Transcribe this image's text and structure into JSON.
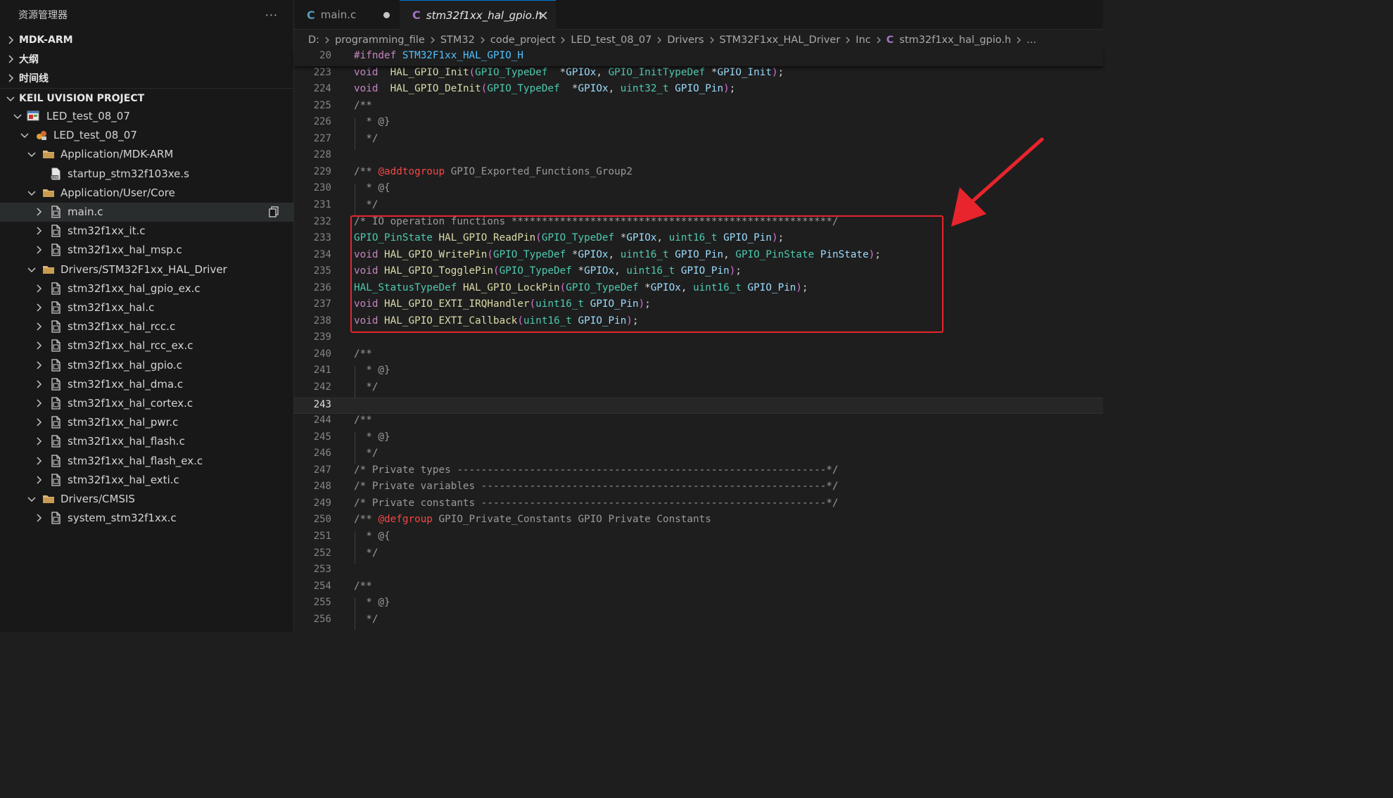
{
  "sidebar": {
    "title": "资源管理器",
    "more_label": "···",
    "sections": [
      {
        "label": "MDK-ARM",
        "expanded": false
      },
      {
        "label": "大纲",
        "expanded": false
      },
      {
        "label": "时间线",
        "expanded": false
      },
      {
        "label": "KEIL UVISION PROJECT",
        "expanded": true
      }
    ],
    "tree": [
      {
        "label": "LED_test_08_07",
        "depth": 0,
        "chevron": "down",
        "icon": "keil-project-icon"
      },
      {
        "label": "LED_test_08_07",
        "depth": 1,
        "chevron": "down",
        "icon": "keil-target-icon"
      },
      {
        "label": "Application/MDK-ARM",
        "depth": 2,
        "chevron": "down",
        "icon": "folder-icon"
      },
      {
        "label": "startup_stm32f103xe.s",
        "depth": 3,
        "chevron": "none",
        "icon": "asm-file-icon"
      },
      {
        "label": "Application/User/Core",
        "depth": 2,
        "chevron": "down",
        "icon": "folder-icon"
      },
      {
        "label": "main.c",
        "depth": 3,
        "chevron": "right",
        "icon": "c-file-icon",
        "selected": true
      },
      {
        "label": "stm32f1xx_it.c",
        "depth": 3,
        "chevron": "right",
        "icon": "c-file-icon"
      },
      {
        "label": "stm32f1xx_hal_msp.c",
        "depth": 3,
        "chevron": "right",
        "icon": "c-file-icon"
      },
      {
        "label": "Drivers/STM32F1xx_HAL_Driver",
        "depth": 2,
        "chevron": "down",
        "icon": "folder-icon"
      },
      {
        "label": "stm32f1xx_hal_gpio_ex.c",
        "depth": 3,
        "chevron": "right",
        "icon": "c-file-icon"
      },
      {
        "label": "stm32f1xx_hal.c",
        "depth": 3,
        "chevron": "right",
        "icon": "c-file-icon"
      },
      {
        "label": "stm32f1xx_hal_rcc.c",
        "depth": 3,
        "chevron": "right",
        "icon": "c-file-icon"
      },
      {
        "label": "stm32f1xx_hal_rcc_ex.c",
        "depth": 3,
        "chevron": "right",
        "icon": "c-file-icon"
      },
      {
        "label": "stm32f1xx_hal_gpio.c",
        "depth": 3,
        "chevron": "right",
        "icon": "c-file-icon"
      },
      {
        "label": "stm32f1xx_hal_dma.c",
        "depth": 3,
        "chevron": "right",
        "icon": "c-file-icon"
      },
      {
        "label": "stm32f1xx_hal_cortex.c",
        "depth": 3,
        "chevron": "right",
        "icon": "c-file-icon"
      },
      {
        "label": "stm32f1xx_hal_pwr.c",
        "depth": 3,
        "chevron": "right",
        "icon": "c-file-icon"
      },
      {
        "label": "stm32f1xx_hal_flash.c",
        "depth": 3,
        "chevron": "right",
        "icon": "c-file-icon"
      },
      {
        "label": "stm32f1xx_hal_flash_ex.c",
        "depth": 3,
        "chevron": "right",
        "icon": "c-file-icon"
      },
      {
        "label": "stm32f1xx_hal_exti.c",
        "depth": 3,
        "chevron": "right",
        "icon": "c-file-icon"
      },
      {
        "label": "Drivers/CMSIS",
        "depth": 2,
        "chevron": "down",
        "icon": "folder-icon"
      },
      {
        "label": "system_stm32f1xx.c",
        "depth": 3,
        "chevron": "right",
        "icon": "c-file-icon"
      }
    ]
  },
  "tabs": [
    {
      "icon_letter": "C",
      "label": "main.c",
      "active": false,
      "modified": true
    },
    {
      "icon_letter": "C",
      "label": "stm32f1xx_hal_gpio.h",
      "active": true,
      "modified": false
    }
  ],
  "breadcrumb": {
    "parts": [
      "D:",
      "programming_file",
      "STM32",
      "code_project",
      "LED_test_08_07",
      "Drivers",
      "STM32F1xx_HAL_Driver",
      "Inc"
    ],
    "file_icon": "C",
    "file": "stm32f1xx_hal_gpio.h",
    "trailing": "..."
  },
  "editor": {
    "current_line": "243",
    "highlighted_range": [
      "232",
      "238"
    ],
    "lines": [
      {
        "n": "20",
        "sticky": true,
        "tokens": [
          [
            "k",
            "#ifndef"
          ],
          [
            "",
            ""
          ],
          [
            "mac",
            " STM32F1xx_HAL_GPIO_H"
          ]
        ]
      },
      {
        "n": "223",
        "tokens": [
          [
            "k",
            "void"
          ],
          [
            "",
            "  "
          ],
          [
            "f",
            "HAL_GPIO_Init"
          ],
          [
            "p",
            "("
          ],
          [
            "t",
            "GPIO_TypeDef"
          ],
          [
            "",
            "  *"
          ],
          [
            "v",
            "GPIOx"
          ],
          [
            "",
            ", "
          ],
          [
            "t",
            "GPIO_InitTypeDef"
          ],
          [
            "",
            " *"
          ],
          [
            "v",
            "GPIO_Init"
          ],
          [
            "p",
            ")"
          ],
          [
            "",
            ";"
          ]
        ]
      },
      {
        "n": "224",
        "tokens": [
          [
            "k",
            "void"
          ],
          [
            "",
            "  "
          ],
          [
            "f",
            "HAL_GPIO_DeInit"
          ],
          [
            "p",
            "("
          ],
          [
            "t",
            "GPIO_TypeDef"
          ],
          [
            "",
            "  *"
          ],
          [
            "v",
            "GPIOx"
          ],
          [
            "",
            ", "
          ],
          [
            "t",
            "uint32_t"
          ],
          [
            "",
            " "
          ],
          [
            "v",
            "GPIO_Pin"
          ],
          [
            "p",
            ")"
          ],
          [
            "",
            ";"
          ]
        ]
      },
      {
        "n": "225",
        "tokens": [
          [
            "cm",
            "/**"
          ]
        ]
      },
      {
        "n": "226",
        "tokens": [
          [
            "cm",
            "  * @}"
          ]
        ]
      },
      {
        "n": "227",
        "tokens": [
          [
            "cm",
            "  */"
          ]
        ]
      },
      {
        "n": "228",
        "tokens": []
      },
      {
        "n": "229",
        "tokens": [
          [
            "cm",
            "/** "
          ],
          [
            "tag",
            "@addtogroup"
          ],
          [
            "cm",
            " GPIO_Exported_Functions_Group2"
          ]
        ]
      },
      {
        "n": "230",
        "tokens": [
          [
            "cm",
            "  * @{"
          ]
        ]
      },
      {
        "n": "231",
        "tokens": [
          [
            "cm",
            "  */"
          ]
        ]
      },
      {
        "n": "232",
        "tokens": [
          [
            "cm",
            "/* IO operation functions *****************************************************/"
          ]
        ]
      },
      {
        "n": "233",
        "tokens": [
          [
            "t",
            "GPIO_PinState"
          ],
          [
            "",
            " "
          ],
          [
            "f",
            "HAL_GPIO_ReadPin"
          ],
          [
            "p",
            "("
          ],
          [
            "t",
            "GPIO_TypeDef"
          ],
          [
            "",
            " *"
          ],
          [
            "v",
            "GPIOx"
          ],
          [
            "",
            ", "
          ],
          [
            "t",
            "uint16_t"
          ],
          [
            "",
            " "
          ],
          [
            "v",
            "GPIO_Pin"
          ],
          [
            "p",
            ")"
          ],
          [
            "",
            ";"
          ]
        ]
      },
      {
        "n": "234",
        "tokens": [
          [
            "k",
            "void"
          ],
          [
            "",
            " "
          ],
          [
            "f",
            "HAL_GPIO_WritePin"
          ],
          [
            "p",
            "("
          ],
          [
            "t",
            "GPIO_TypeDef"
          ],
          [
            "",
            " *"
          ],
          [
            "v",
            "GPIOx"
          ],
          [
            "",
            ", "
          ],
          [
            "t",
            "uint16_t"
          ],
          [
            "",
            " "
          ],
          [
            "v",
            "GPIO_Pin"
          ],
          [
            "",
            ", "
          ],
          [
            "t",
            "GPIO_PinState"
          ],
          [
            "",
            " "
          ],
          [
            "v",
            "PinState"
          ],
          [
            "p",
            ")"
          ],
          [
            "",
            ";"
          ]
        ]
      },
      {
        "n": "235",
        "tokens": [
          [
            "k",
            "void"
          ],
          [
            "",
            " "
          ],
          [
            "f",
            "HAL_GPIO_TogglePin"
          ],
          [
            "p",
            "("
          ],
          [
            "t",
            "GPIO_TypeDef"
          ],
          [
            "",
            " *"
          ],
          [
            "v",
            "GPIOx"
          ],
          [
            "",
            ", "
          ],
          [
            "t",
            "uint16_t"
          ],
          [
            "",
            " "
          ],
          [
            "v",
            "GPIO_Pin"
          ],
          [
            "p",
            ")"
          ],
          [
            "",
            ";"
          ]
        ]
      },
      {
        "n": "236",
        "tokens": [
          [
            "t",
            "HAL_StatusTypeDef"
          ],
          [
            "",
            " "
          ],
          [
            "f",
            "HAL_GPIO_LockPin"
          ],
          [
            "p",
            "("
          ],
          [
            "t",
            "GPIO_TypeDef"
          ],
          [
            "",
            " *"
          ],
          [
            "v",
            "GPIOx"
          ],
          [
            "",
            ", "
          ],
          [
            "t",
            "uint16_t"
          ],
          [
            "",
            " "
          ],
          [
            "v",
            "GPIO_Pin"
          ],
          [
            "p",
            ")"
          ],
          [
            "",
            ";"
          ]
        ]
      },
      {
        "n": "237",
        "tokens": [
          [
            "k",
            "void"
          ],
          [
            "",
            " "
          ],
          [
            "f",
            "HAL_GPIO_EXTI_IRQHandler"
          ],
          [
            "p",
            "("
          ],
          [
            "t",
            "uint16_t"
          ],
          [
            "",
            " "
          ],
          [
            "v",
            "GPIO_Pin"
          ],
          [
            "p",
            ")"
          ],
          [
            "",
            ";"
          ]
        ]
      },
      {
        "n": "238",
        "tokens": [
          [
            "k",
            "void"
          ],
          [
            "",
            " "
          ],
          [
            "f",
            "HAL_GPIO_EXTI_Callback"
          ],
          [
            "p",
            "("
          ],
          [
            "t",
            "uint16_t"
          ],
          [
            "",
            " "
          ],
          [
            "v",
            "GPIO_Pin"
          ],
          [
            "p",
            ")"
          ],
          [
            "",
            ";"
          ]
        ]
      },
      {
        "n": "239",
        "tokens": []
      },
      {
        "n": "240",
        "tokens": [
          [
            "cm",
            "/**"
          ]
        ]
      },
      {
        "n": "241",
        "tokens": [
          [
            "cm",
            "  * @}"
          ]
        ]
      },
      {
        "n": "242",
        "tokens": [
          [
            "cm",
            "  */"
          ]
        ]
      },
      {
        "n": "243",
        "tokens": []
      },
      {
        "n": "244",
        "tokens": [
          [
            "cm",
            "/**"
          ]
        ]
      },
      {
        "n": "245",
        "tokens": [
          [
            "cm",
            "  * @}"
          ]
        ]
      },
      {
        "n": "246",
        "tokens": [
          [
            "cm",
            "  */"
          ]
        ]
      },
      {
        "n": "247",
        "tokens": [
          [
            "cm",
            "/* Private types -------------------------------------------------------------*/"
          ]
        ]
      },
      {
        "n": "248",
        "tokens": [
          [
            "cm",
            "/* Private variables ---------------------------------------------------------*/"
          ]
        ]
      },
      {
        "n": "249",
        "tokens": [
          [
            "cm",
            "/* Private constants ---------------------------------------------------------*/"
          ]
        ]
      },
      {
        "n": "250",
        "tokens": [
          [
            "cm",
            "/** "
          ],
          [
            "tag",
            "@defgroup"
          ],
          [
            "cm",
            " GPIO_Private_Constants GPIO Private Constants"
          ]
        ]
      },
      {
        "n": "251",
        "tokens": [
          [
            "cm",
            "  * @{"
          ]
        ]
      },
      {
        "n": "252",
        "tokens": [
          [
            "cm",
            "  */"
          ]
        ]
      },
      {
        "n": "253",
        "tokens": []
      },
      {
        "n": "254",
        "tokens": [
          [
            "cm",
            "/**"
          ]
        ]
      },
      {
        "n": "255",
        "tokens": [
          [
            "cm",
            "  * @}"
          ]
        ]
      },
      {
        "n": "256",
        "tokens": [
          [
            "cm",
            "  */"
          ]
        ]
      }
    ]
  },
  "annotation": {
    "box_color": "#e8242c",
    "arrow_color": "#e8242c",
    "arrow_icon": "red-arrow-icon"
  }
}
